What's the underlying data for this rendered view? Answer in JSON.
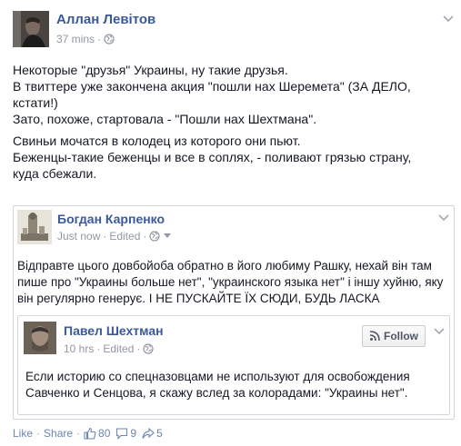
{
  "post": {
    "author": "Аллан Левітов",
    "time": "37 mins",
    "sep": "·",
    "paragraphs": [
      "Некоторые \"друзья\" Украины, ну такие друзья.",
      "В твиттере уже закончена акция \"пошли нах Шеремета\" (ЗА ДЕЛО, кстати!)",
      "Зато, похоже, стартовала - \"Пошли нах Шехтмана\".",
      "Свиньи мочатся в колодец из которого они пьют.",
      "Беженцы-такие беженцы и все в соплях, - поливают грязью страну, куда сбежали."
    ]
  },
  "shared": {
    "author": "Богдан Карпенко",
    "time": "Just now",
    "edited": "Edited",
    "sep": "·",
    "text": "Відправте цього довбойоба обратно в його любиму Рашку, нехай він там пише про \"Украины больше нет\", \"украинского языка нет\" і іншу хуйню, яку він регулярно генерує. І НЕ ПУСКАЙТЕ ЇХ СЮДИ, БУДЬ ЛАСКА"
  },
  "nested": {
    "author": "Павел Шехтман",
    "time": "10 hrs",
    "edited": "Edited",
    "sep": "·",
    "follow_label": "Follow",
    "text": "Если историю со спецназовцами не используют для освобождения Савченко и Сенцова, я скажу вслед за колорадами: \"Украины нет\"."
  },
  "footer": {
    "like": "Like",
    "share": "Share",
    "dot": "·",
    "likes": "80",
    "comments": "9",
    "shares": "5"
  },
  "icons": {
    "globe": "globe-icon",
    "chevron": "chevron-down-icon",
    "like": "thumbs-up-icon",
    "comment": "comment-icon",
    "share": "share-arrow-icon",
    "rss": "rss-icon"
  },
  "colors": {
    "name": "#3b5998",
    "meta": "#9197a3",
    "link": "#6d84b4",
    "text": "#141823",
    "border": "#d3d6db"
  }
}
